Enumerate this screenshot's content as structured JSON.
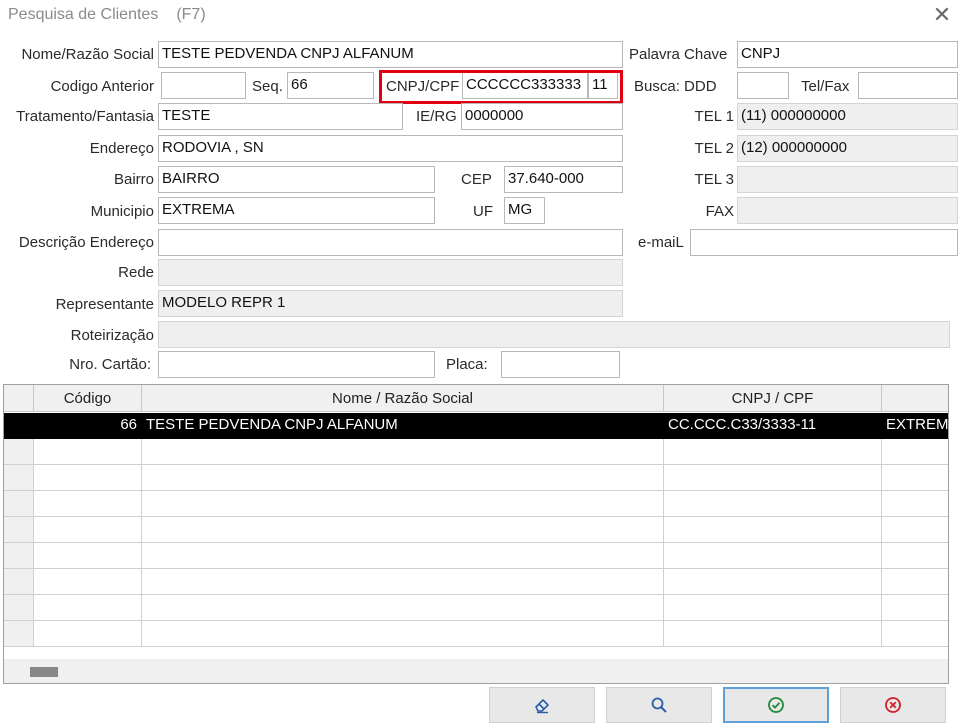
{
  "window": {
    "title": "Pesquisa de Clientes",
    "shortcut": "(F7)",
    "close_glyph": "✕"
  },
  "form": {
    "nome_label": "Nome/Razão Social",
    "nome_value": "TESTE PEDVENDA CNPJ ALFANUM",
    "palavra_chave_label": "Palavra Chave",
    "palavra_chave_value": "CNPJ",
    "codigo_anterior_label": "Codigo Anterior",
    "codigo_anterior_value": "",
    "seq_label": "Seq.",
    "seq_value": "66",
    "cnpj_label": "CNPJ/CPF",
    "cnpj_value": "CCCCCC333333",
    "cnpj_digit": "11",
    "busca_ddd_label": "Busca: DDD",
    "busca_ddd_value": "",
    "tel_fax_label": "Tel/Fax",
    "tel_fax_value": "",
    "tratamento_label": "Tratamento/Fantasia",
    "tratamento_value": "TESTE",
    "ie_label": "IE/RG",
    "ie_value": "0000000",
    "tel1_label": "TEL 1",
    "tel1_value": "(11) 000000000",
    "endereco_label": "Endereço",
    "endereco_value": "RODOVIA , SN",
    "tel2_label": "TEL 2",
    "tel2_value": "(12) 000000000",
    "bairro_label": "Bairro",
    "bairro_value": "BAIRRO",
    "cep_label": "CEP",
    "cep_value": "37.640-000",
    "tel3_label": "TEL 3",
    "tel3_value": "",
    "municipio_label": "Municipio",
    "municipio_value": "EXTREMA",
    "uf_label": "UF",
    "uf_value": "MG",
    "fax_label": "FAX",
    "fax_value": "",
    "descricao_label": "Descrição Endereço",
    "descricao_value": "",
    "email_label": "e-maiL",
    "email_value": "",
    "rede_label": "Rede",
    "rede_value": "",
    "representante_label": "Representante",
    "representante_value": "MODELO REPR 1",
    "roteirizacao_label": "Roteirização",
    "roteirizacao_value": "",
    "cartao_label": "Nro. Cartão:",
    "cartao_value": "",
    "placa_label": "Placa:",
    "placa_value": ""
  },
  "grid": {
    "columns": [
      "Código",
      "Nome / Razão Social",
      "CNPJ / CPF",
      ""
    ],
    "rows": [
      {
        "codigo": "66",
        "nome": "TESTE PEDVENDA CNPJ ALFANUM",
        "cnpj": "CC.CCC.C33/3333-11",
        "municipio": "EXTREMA"
      }
    ]
  },
  "buttons": [
    {
      "name": "clear-button",
      "icon": "eraser-icon"
    },
    {
      "name": "search-button",
      "icon": "search-icon"
    },
    {
      "name": "confirm-button",
      "icon": "check-circle-icon"
    },
    {
      "name": "cancel-button",
      "icon": "x-circle-icon"
    }
  ],
  "colors": {
    "highlight": "#e00010",
    "selected_row": "#000000",
    "confirm_icon": "#1f8a3b",
    "cancel_icon": "#d0202a",
    "icon_blue": "#2a5fa8"
  }
}
